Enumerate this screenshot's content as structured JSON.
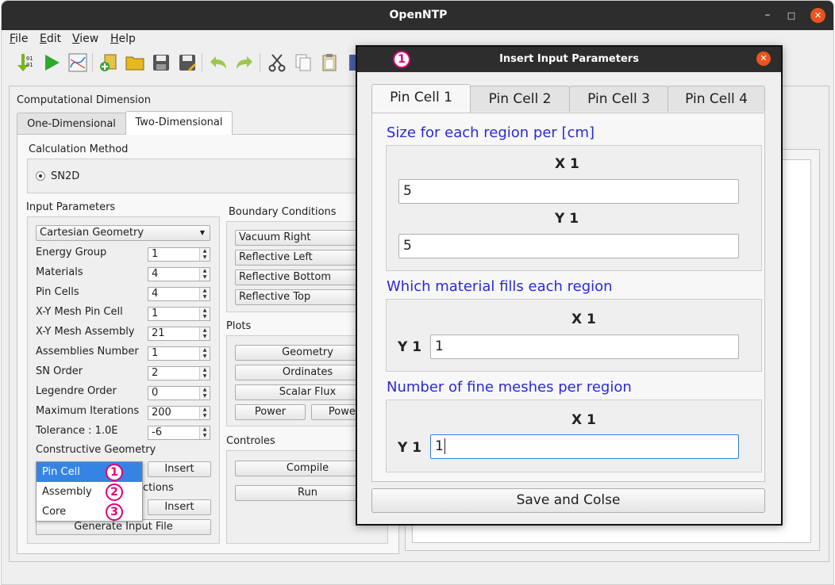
{
  "app": {
    "title": "OpenNTP",
    "window_controls": [
      "minimize-icon",
      "maximize-icon",
      "close-icon"
    ]
  },
  "menu": [
    {
      "accel": "F",
      "rest": "ile"
    },
    {
      "accel": "E",
      "rest": "dit"
    },
    {
      "accel": "V",
      "rest": "iew"
    },
    {
      "accel": "H",
      "rest": "elp"
    }
  ],
  "toolbar_icons": [
    "import-binary-icon",
    "run-icon",
    "plot-icon",
    "add-folder-icon",
    "open-folder-icon",
    "save-icon",
    "save-as-icon",
    "undo-icon",
    "redo-icon",
    "cut-icon",
    "copy-icon",
    "paste-icon"
  ],
  "main": {
    "section_title": "Computational Dimension",
    "tabs": [
      "One-Dimensional",
      "Two-Dimensional"
    ],
    "calc_method": {
      "title": "Calculation Method",
      "option": "SN2D"
    },
    "input_params": {
      "title": "Input Parameters",
      "geometry": "Cartesian Geometry",
      "rows": [
        {
          "label": "Energy Group",
          "value": "1"
        },
        {
          "label": "Materials",
          "value": "4"
        },
        {
          "label": "Pin Cells",
          "value": "4"
        },
        {
          "label": "X-Y Mesh Pin Cell",
          "value": "1"
        },
        {
          "label": "X-Y Mesh Assembly",
          "value": "21"
        },
        {
          "label": "Assemblies Number",
          "value": "1"
        },
        {
          "label": "SN Order",
          "value": "2"
        },
        {
          "label": "Legendre Order",
          "value": "0"
        },
        {
          "label": "Maximum Iterations",
          "value": "200"
        },
        {
          "label": "Tolerance : 1.0E",
          "value": "-6"
        }
      ],
      "constructive_geometry": "Constructive Geometry",
      "insert_label": "Insert",
      "cross_sections_partial": "ctions",
      "insert2_label": "Insert",
      "generate_label": "Generate Input File"
    },
    "boundary": {
      "title": "Boundary Conditions",
      "items": [
        "Vacuum Right",
        "Reflective Left",
        "Reflective Bottom",
        "Reflective Top"
      ]
    },
    "plots": {
      "title": "Plots",
      "geometry": "Geometry",
      "ordinates": "Ordinates",
      "scalar_flux": "Scalar Flux",
      "power": "Power",
      "power2": "PowerI"
    },
    "controles": {
      "title": "Controles",
      "compile": "Compile",
      "run": "Run"
    }
  },
  "popup": {
    "items": [
      {
        "label": "Pin Cell",
        "marker": "1"
      },
      {
        "label": "Assembly",
        "marker": "2"
      },
      {
        "label": "Core",
        "marker": "3"
      }
    ]
  },
  "dialog": {
    "marker": "1",
    "title": "Insert Input Parameters",
    "tabs": [
      "Pin Cell 1",
      "Pin Cell 2",
      "Pin Cell 3",
      "Pin Cell 4"
    ],
    "size_section": {
      "title": "Size for each region per [cm]",
      "x_label": "X 1",
      "x_value": "5",
      "y_label": "Y 1",
      "y_value": "5"
    },
    "material_section": {
      "title": "Which material fills each region",
      "x_label": "X 1",
      "y_label": "Y 1",
      "value": "1"
    },
    "mesh_section": {
      "title": "Number of fine meshes per region",
      "x_label": "X 1",
      "y_label": "Y 1",
      "value": "1"
    },
    "save_label": "Save and Colse"
  },
  "colors": {
    "titlebar": "#2d2d2d",
    "close": "#e95420",
    "section_text": "#2a2ad6",
    "marker": "#e2007a",
    "selection": "#3584e4"
  }
}
